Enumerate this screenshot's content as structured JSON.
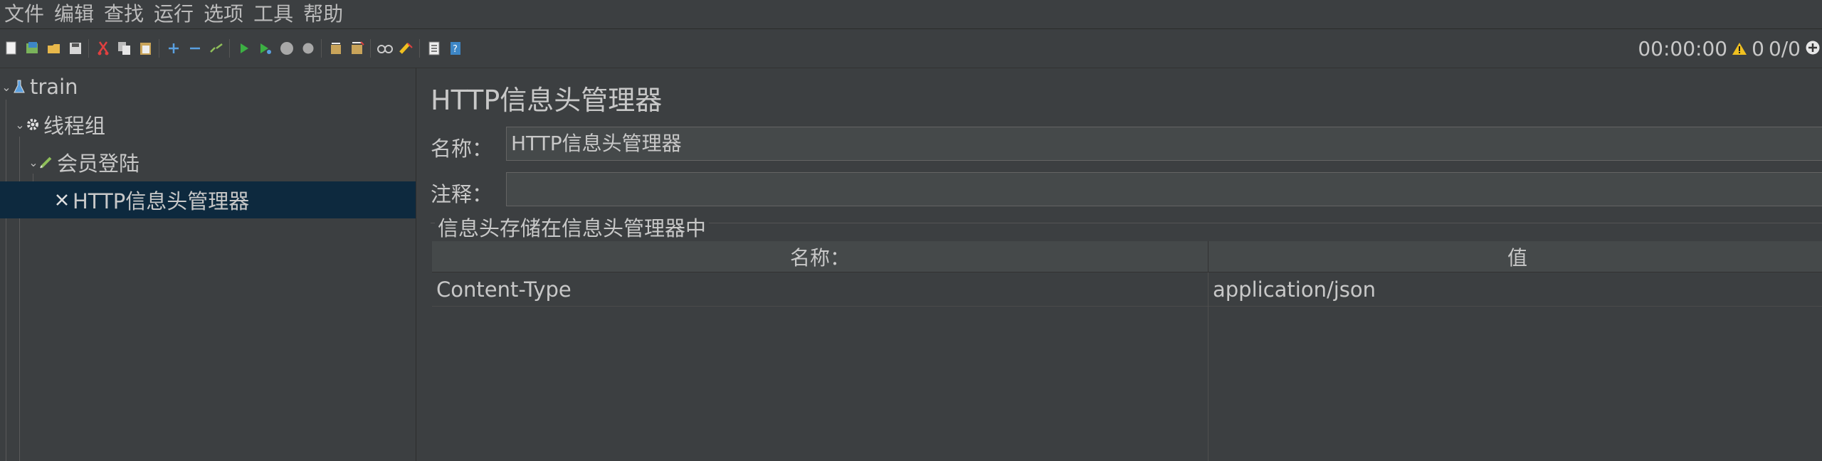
{
  "menu": [
    "文件",
    "编辑",
    "查找",
    "运行",
    "选项",
    "工具",
    "帮助"
  ],
  "toolbar": {
    "icons": [
      "new-icon",
      "templates-icon",
      "open-icon",
      "save-icon",
      "cut-icon",
      "copy-icon",
      "paste-icon",
      "expand-icon",
      "collapse-icon",
      "toggle-icon",
      "start-icon",
      "start-no-pause-icon",
      "stop-icon",
      "shutdown-icon",
      "clear-icon",
      "clear-all-icon",
      "search-icon",
      "reset-search-icon",
      "function-helper-icon",
      "help-icon"
    ]
  },
  "status": {
    "timer": "00:00:00",
    "warnings": "0",
    "threads": "0/0"
  },
  "tree": {
    "items": [
      {
        "label": "train",
        "level": 0,
        "icon": "flask-icon"
      },
      {
        "label": "线程组",
        "level": 1,
        "icon": "gear-icon"
      },
      {
        "label": "会员登陆",
        "level": 2,
        "icon": "pencil-icon"
      },
      {
        "label": "HTTP信息头管理器",
        "level": 3,
        "icon": "wrench-icon",
        "selected": true
      }
    ]
  },
  "panel": {
    "title": "HTTP信息头管理器",
    "name_label": "名称：",
    "name_value": "HTTP信息头管理器",
    "comment_label": "注释：",
    "comment_value": "",
    "group_title": "信息头存储在信息头管理器中",
    "table": {
      "headers": [
        "名称：",
        "值"
      ],
      "rows": [
        {
          "name": "Content-Type",
          "value": "application/json"
        }
      ]
    }
  },
  "colors": {
    "background": "#3c3f41",
    "selection": "#0d293e",
    "text": "#bbbbbb"
  }
}
